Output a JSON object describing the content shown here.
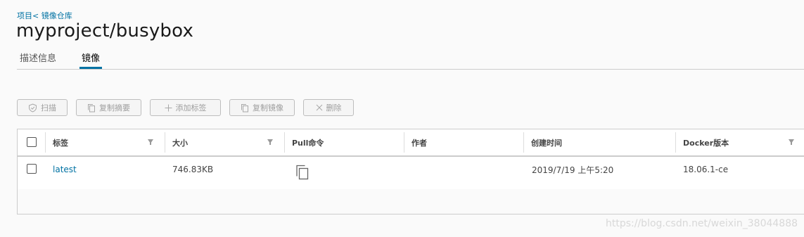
{
  "breadcrumb": "项目< 镜像仓库",
  "page_title": "myproject/busybox",
  "tabs": [
    {
      "label": "描述信息",
      "active": false
    },
    {
      "label": "镜像",
      "active": true
    }
  ],
  "toolbar": {
    "scan_label": "扫描",
    "copy_digest_label": "复制摘要",
    "add_tag_label": "添加标签",
    "copy_image_label": "复制镜像",
    "delete_label": "删除"
  },
  "grid": {
    "columns": [
      "标签",
      "大小",
      "Pull命令",
      "作者",
      "创建时间",
      "Docker版本"
    ],
    "rows": [
      {
        "tag": "latest",
        "size": "746.83KB",
        "pull_command_icon": "copy-icon",
        "author": "",
        "created": "2019/7/19 上午5:20",
        "docker_version": "18.06.1-ce"
      }
    ]
  },
  "watermark": "https://blog.csdn.net/weixin_38044888",
  "colors": {
    "accent": "#0072a3",
    "border": "#cccccc"
  }
}
